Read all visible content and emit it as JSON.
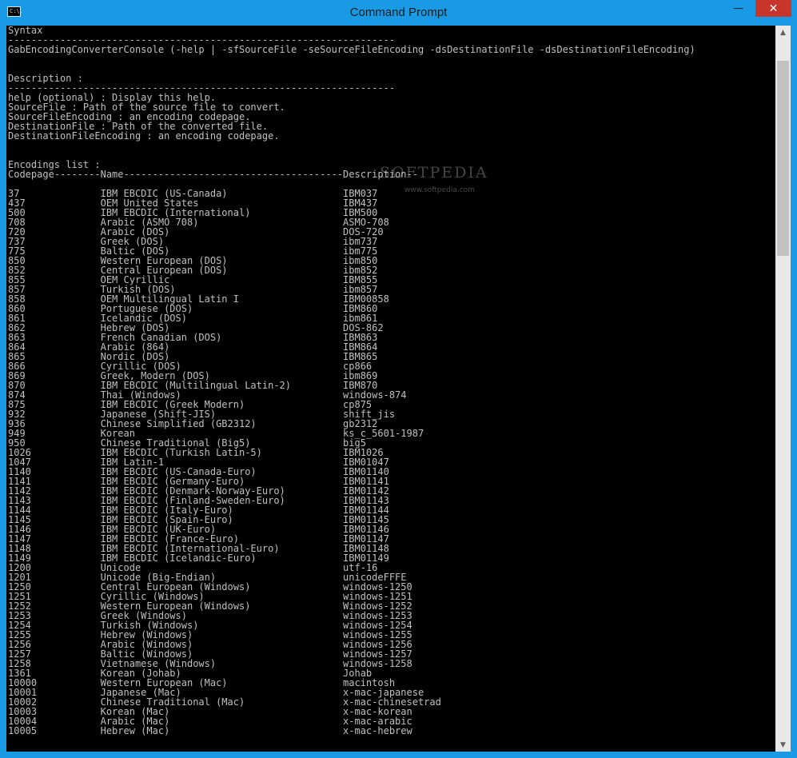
{
  "window": {
    "title": "Command Prompt",
    "icon": "cmd-icon",
    "icon_text": "C:\\.",
    "minimize": "—",
    "maximize": "☐",
    "close": "✕"
  },
  "scrollbar": {
    "up": "▲",
    "down": "▼"
  },
  "watermark": {
    "text": "SOFTPEDIA",
    "url": "www.softpedia.com"
  },
  "console_lines": [
    "Syntax",
    "-------------------------------------------------------------------",
    "GabEncodingConverterConsole (-help | -sfSourceFile -seSourceFileEncoding -dsDestinationFile -dsDestinationFileEncoding)",
    "",
    "",
    "Description :",
    "-------------------------------------------------------------------",
    "help (optional) : Display this help.",
    "SourceFile : Path of the source file to convert.",
    "SourceFileEncoding : an encoding codepage.",
    "DestinationFile : Path of the converted file.",
    "DestinationFileEncoding : an encoding codepage.",
    "",
    "",
    "Encodings list :",
    "Codepage--------Name--------------------------------------Description--",
    "",
    "37              IBM EBCDIC (US-Canada)                    IBM037",
    "437             OEM United States                         IBM437",
    "500             IBM EBCDIC (International)                IBM500",
    "708             Arabic (ASMO 708)                         ASMO-708",
    "720             Arabic (DOS)                              DOS-720",
    "737             Greek (DOS)                               ibm737",
    "775             Baltic (DOS)                              ibm775",
    "850             Western European (DOS)                    ibm850",
    "852             Central European (DOS)                    ibm852",
    "855             OEM Cyrillic                              IBM855",
    "857             Turkish (DOS)                             ibm857",
    "858             OEM Multilingual Latin I                  IBM00858",
    "860             Portuguese (DOS)                          IBM860",
    "861             Icelandic (DOS)                           ibm861",
    "862             Hebrew (DOS)                              DOS-862",
    "863             French Canadian (DOS)                     IBM863",
    "864             Arabic (864)                              IBM864",
    "865             Nordic (DOS)                              IBM865",
    "866             Cyrillic (DOS)                            cp866",
    "869             Greek, Modern (DOS)                       ibm869",
    "870             IBM EBCDIC (Multilingual Latin-2)         IBM870",
    "874             Thai (Windows)                            windows-874",
    "875             IBM EBCDIC (Greek Modern)                 cp875",
    "932             Japanese (Shift-JIS)                      shift_jis",
    "936             Chinese Simplified (GB2312)               gb2312",
    "949             Korean                                    ks_c_5601-1987",
    "950             Chinese Traditional (Big5)                big5",
    "1026            IBM EBCDIC (Turkish Latin-5)              IBM1026",
    "1047            IBM Latin-1                               IBM01047",
    "1140            IBM EBCDIC (US-Canada-Euro)               IBM01140",
    "1141            IBM EBCDIC (Germany-Euro)                 IBM01141",
    "1142            IBM EBCDIC (Denmark-Norway-Euro)          IBM01142",
    "1143            IBM EBCDIC (Finland-Sweden-Euro)          IBM01143",
    "1144            IBM EBCDIC (Italy-Euro)                   IBM01144",
    "1145            IBM EBCDIC (Spain-Euro)                   IBM01145",
    "1146            IBM EBCDIC (UK-Euro)                      IBM01146",
    "1147            IBM EBCDIC (France-Euro)                  IBM01147",
    "1148            IBM EBCDIC (International-Euro)           IBM01148",
    "1149            IBM EBCDIC (Icelandic-Euro)               IBM01149",
    "1200            Unicode                                   utf-16",
    "1201            Unicode (Big-Endian)                      unicodeFFFE",
    "1250            Central European (Windows)                windows-1250",
    "1251            Cyrillic (Windows)                        windows-1251",
    "1252            Western European (Windows)                Windows-1252",
    "1253            Greek (Windows)                           windows-1253",
    "1254            Turkish (Windows)                         windows-1254",
    "1255            Hebrew (Windows)                          windows-1255",
    "1256            Arabic (Windows)                          windows-1256",
    "1257            Baltic (Windows)                          windows-1257",
    "1258            Vietnamese (Windows)                      windows-1258",
    "1361            Korean (Johab)                            Johab",
    "10000           Western European (Mac)                    macintosh",
    "10001           Japanese (Mac)                            x-mac-japanese",
    "10002           Chinese Traditional (Mac)                 x-mac-chinesetrad",
    "10003           Korean (Mac)                              x-mac-korean",
    "10004           Arabic (Mac)                              x-mac-arabic",
    "10005           Hebrew (Mac)                              x-mac-hebrew"
  ]
}
